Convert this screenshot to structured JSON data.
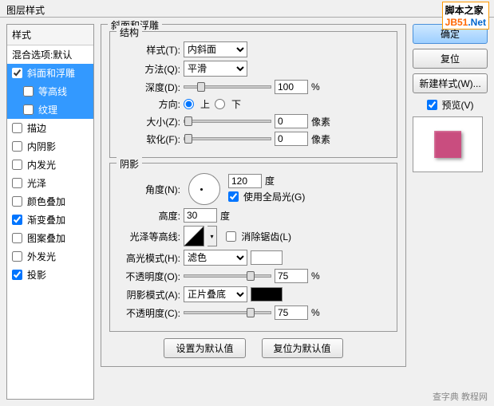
{
  "window": {
    "title": "图层样式"
  },
  "sidebar": {
    "header": "样式",
    "blending": "混合选项:默认",
    "items": [
      {
        "label": "斜面和浮雕",
        "checked": true,
        "selected": true,
        "indent": false
      },
      {
        "label": "等高线",
        "checked": false,
        "selected": true,
        "indent": true
      },
      {
        "label": "纹理",
        "checked": false,
        "selected": true,
        "indent": true
      },
      {
        "label": "描边",
        "checked": false,
        "selected": false,
        "indent": false
      },
      {
        "label": "内阴影",
        "checked": false,
        "selected": false,
        "indent": false
      },
      {
        "label": "内发光",
        "checked": false,
        "selected": false,
        "indent": false
      },
      {
        "label": "光泽",
        "checked": false,
        "selected": false,
        "indent": false
      },
      {
        "label": "颜色叠加",
        "checked": false,
        "selected": false,
        "indent": false
      },
      {
        "label": "渐变叠加",
        "checked": true,
        "selected": false,
        "indent": false
      },
      {
        "label": "图案叠加",
        "checked": false,
        "selected": false,
        "indent": false
      },
      {
        "label": "外发光",
        "checked": false,
        "selected": false,
        "indent": false
      },
      {
        "label": "投影",
        "checked": true,
        "selected": false,
        "indent": false
      }
    ]
  },
  "panel": {
    "title": "斜面和浮雕",
    "structure": {
      "legend": "结构",
      "style_label": "样式(T):",
      "style_value": "内斜面",
      "method_label": "方法(Q):",
      "method_value": "平滑",
      "depth_label": "深度(D):",
      "depth_value": "100",
      "depth_unit": "%",
      "direction_label": "方向:",
      "up": "上",
      "down": "下",
      "size_label": "大小(Z):",
      "size_value": "0",
      "size_unit": "像素",
      "soften_label": "软化(F):",
      "soften_value": "0",
      "soften_unit": "像素"
    },
    "shading": {
      "legend": "阴影",
      "angle_label": "角度(N):",
      "angle_value": "120",
      "angle_unit": "度",
      "global_label": "使用全局光(G)",
      "altitude_label": "高度:",
      "altitude_value": "30",
      "altitude_unit": "度",
      "gloss_label": "光泽等高线:",
      "antialias_label": "消除锯齿(L)",
      "highlight_mode_label": "高光模式(H):",
      "highlight_mode_value": "滤色",
      "highlight_opacity_label": "不透明度(O):",
      "highlight_opacity_value": "75",
      "opacity_unit": "%",
      "shadow_mode_label": "阴影模式(A):",
      "shadow_mode_value": "正片叠底",
      "shadow_opacity_label": "不透明度(C):",
      "shadow_opacity_value": "75"
    },
    "buttons": {
      "default": "设置为默认值",
      "reset": "复位为默认值"
    }
  },
  "right": {
    "ok": "确定",
    "cancel": "复位",
    "new_style": "新建样式(W)...",
    "preview": "预览(V)"
  },
  "watermark": {
    "site": "脚本之家",
    "jb": "JB51",
    "net": ".Net",
    "footer": "查字典 教程网"
  }
}
